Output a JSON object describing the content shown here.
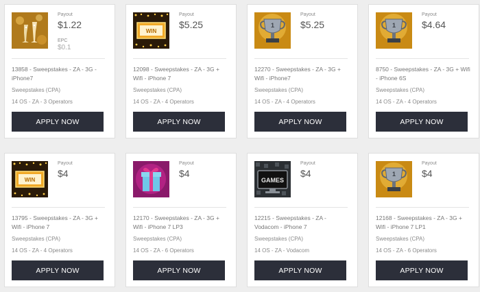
{
  "offers": [
    {
      "icon": "champagne-icon",
      "payout_label": "Payout",
      "payout": "$1.22",
      "epc_label": "EPC",
      "epc": "$0.1",
      "title": "13858 - Sweepstakes - ZA - 3G - iPhone7",
      "category": "Sweepstakes (CPA)",
      "meta": "14 OS - ZA - 3 Operators",
      "button": "APPLY NOW"
    },
    {
      "icon": "win-sign-icon",
      "payout_label": "Payout",
      "payout": "$5.25",
      "title": "12098 - Sweepstakes - ZA - 3G + Wifi - iPhone 7",
      "category": "Sweepstakes (CPA)",
      "meta": "14 OS - ZA - 4 Operators",
      "button": "APPLY NOW"
    },
    {
      "icon": "trophy-icon",
      "payout_label": "Payout",
      "payout": "$5.25",
      "title": "12270 - Sweepstakes - ZA - 3G + Wifi - iPhone7",
      "category": "Sweepstakes (CPA)",
      "meta": "14 OS - ZA - 4 Operators",
      "button": "APPLY NOW"
    },
    {
      "icon": "trophy-icon",
      "payout_label": "Payout",
      "payout": "$4.64",
      "title": "8750 - Sweepstakes - ZA - 3G + Wifi - iPhone 6S",
      "category": "Sweepstakes (CPA)",
      "meta": "14 OS - ZA - 4 Operators",
      "button": "APPLY NOW"
    },
    {
      "icon": "win-sign-icon",
      "payout_label": "Payout",
      "payout": "$4",
      "title": "13795 - Sweepstakes - ZA - 3G + Wifi - iPhone 7",
      "category": "Sweepstakes (CPA)",
      "meta": "14 OS - ZA - 4 Operators",
      "button": "APPLY NOW"
    },
    {
      "icon": "gift-box-icon",
      "payout_label": "Payout",
      "payout": "$4",
      "title": "12170 - Sweepstakes - ZA - 3G + Wifi - iPhone 7 LP3",
      "category": "Sweepstakes (CPA)",
      "meta": "14 OS - ZA - 6 Operators",
      "button": "APPLY NOW"
    },
    {
      "icon": "games-tv-icon",
      "payout_label": "Payout",
      "payout": "$4",
      "title": "12215 - Sweepstakes - ZA - Vodacom - iPhone 7",
      "category": "Sweepstakes (CPA)",
      "meta": "14 OS - ZA - Vodacom",
      "button": "APPLY NOW",
      "icon_text": "GAMES"
    },
    {
      "icon": "trophy-icon",
      "payout_label": "Payout",
      "payout": "$4",
      "title": "12168 - Sweepstakes - ZA - 3G + Wifi - iPhone 7 LP1",
      "category": "Sweepstakes (CPA)",
      "meta": "14 OS - ZA - 6 Operators",
      "button": "APPLY NOW"
    }
  ],
  "win_sign_text": "WIN",
  "colors": {
    "button": "#2c2f3a",
    "background": "#eeeeee",
    "card": "#ffffff"
  }
}
